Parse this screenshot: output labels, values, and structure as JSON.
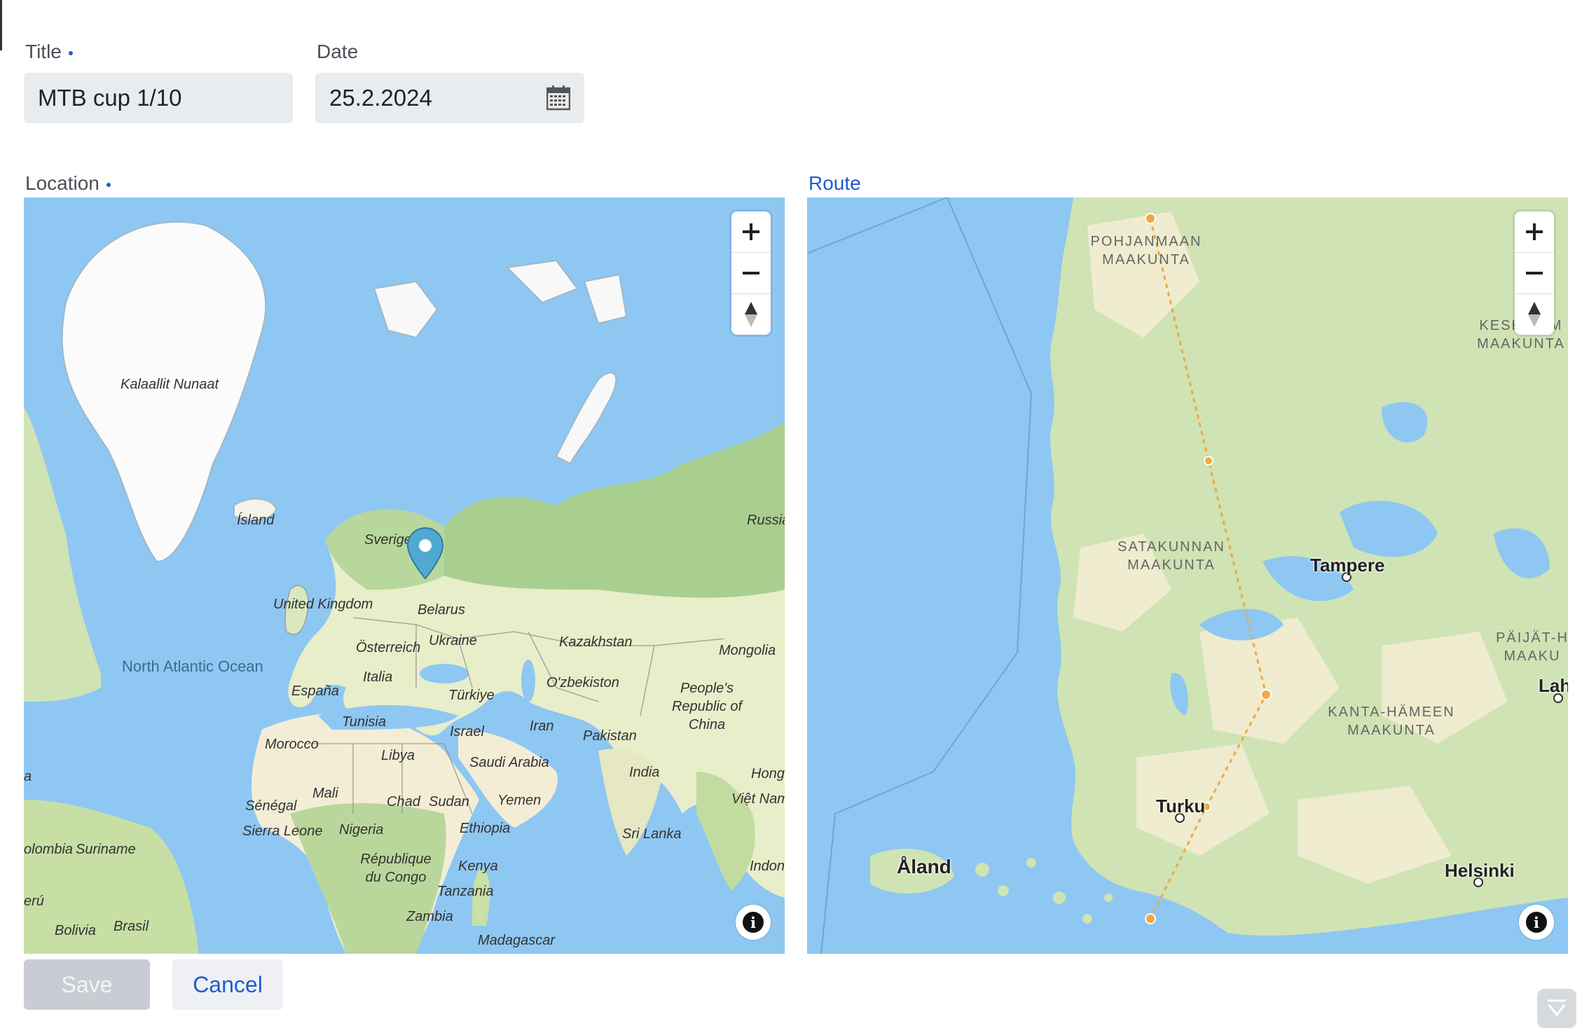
{
  "form": {
    "title_label": "Title",
    "title_value": "MTB cup 1/10",
    "date_label": "Date",
    "date_value": "25.2.2024",
    "location_label": "Location",
    "route_label": "Route"
  },
  "location_map": {
    "labels": {
      "greenland": "Kalaallit Nunaat",
      "iceland": "Ísland",
      "sweden": "Sverige",
      "russia": "Russia",
      "uk": "United Kingdom",
      "belarus": "Belarus",
      "ukraine": "Ukraine",
      "austria": "Österreich",
      "kazakhstan": "Kazakhstan",
      "mongolia": "Mongolia",
      "ocean": "North Atlantic Ocean",
      "italy": "Italia",
      "spain": "España",
      "turkey": "Türkiye",
      "uzbekistan": "O'zbekiston",
      "china": "People's Republic of China",
      "tunisia": "Tunisia",
      "israel": "Israel",
      "iran": "Iran",
      "pakistan": "Pakistan",
      "morocco": "Morocco",
      "libya": "Libya",
      "saudi": "Saudi Arabia",
      "india": "India",
      "hong": "Hong",
      "vietnam": "Việt Nam",
      "mali": "Mali",
      "chad": "Chad",
      "sudan": "Sudan",
      "yemen": "Yemen",
      "senegal": "Sénégal",
      "sierra": "Sierra Leone",
      "nigeria": "Nigeria",
      "ethiopia": "Ethiopia",
      "srilanka": "Sri Lanka",
      "indon": "Indon",
      "colombia": "olombia",
      "suriname": "Suriname",
      "congo": "République du Congo",
      "kenya": "Kenya",
      "peru": "erú",
      "tanzania": "Tanzania",
      "zambia": "Zambia",
      "bolivia": "Bolivia",
      "brasil": "Brasil",
      "madagascar": "Madagascar",
      "edge_a": "a"
    }
  },
  "route_map": {
    "labels": {
      "pohjanmaan": "POHJANMAAN MAAKUNTA",
      "satakunnan": "SATAKUNNAN MAAKUNTA",
      "keski": "KESKI-S  M MAAKUNTA",
      "paijat": "PÄIJÄT-H MAAKU",
      "kanta": "KANTA-HÄMEEN MAAKUNTA",
      "tampere": "Tampere",
      "lah": "Lah",
      "turku": "Turku",
      "aland": "Åland",
      "helsinki": "Helsinki"
    }
  },
  "actions": {
    "save_label": "Save",
    "cancel_label": "Cancel"
  },
  "colors": {
    "accent": "#1f5bd1",
    "sea": "#8ec7f2",
    "land": "#cfe3b4",
    "route": "#f0a845",
    "marker": "#4fa9d1"
  }
}
